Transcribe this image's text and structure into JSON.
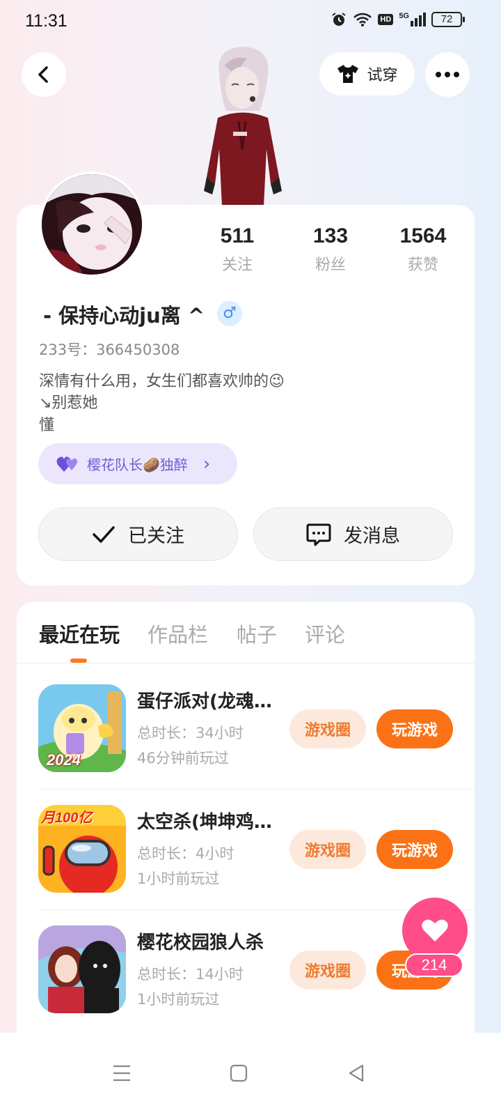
{
  "status_bar": {
    "time": "11:31",
    "network": "5G",
    "hd": "HD",
    "battery": "72"
  },
  "header": {
    "back_icon": "chevron-left-icon",
    "tryon_label": "试穿",
    "more_icon": "more-dots-icon"
  },
  "profile": {
    "stats": [
      {
        "value": "511",
        "label": "关注"
      },
      {
        "value": "133",
        "label": "粉丝"
      },
      {
        "value": "1564",
        "label": "获赞"
      }
    ],
    "username": "- 保持心动ju离 ^",
    "gender_symbol": "♂",
    "uid": "233号：366450308",
    "bio": [
      "深情有什么用，女生们都喜欢帅的😉",
      "↘别惹她",
      "懂"
    ],
    "tag": {
      "text": "樱花队长🥔独醉",
      "arrow": "›"
    },
    "follow_label": "已关注",
    "message_label": "发消息"
  },
  "tabs": [
    {
      "label": "最近在玩",
      "active": true
    },
    {
      "label": "作品栏",
      "active": false
    },
    {
      "label": "帖子",
      "active": false
    },
    {
      "label": "评论",
      "active": false
    }
  ],
  "games": [
    {
      "title": "蛋仔派对(龙魂…",
      "duration": "总时长：34小时",
      "last_played": "46分钟前玩过",
      "circle_label": "游戏圈",
      "play_label": "玩游戏"
    },
    {
      "title": "太空杀(坤坤鸡…",
      "duration": "总时长：4小时",
      "last_played": "1小时前玩过",
      "circle_label": "游戏圈",
      "play_label": "玩游戏"
    },
    {
      "title": "樱花校园狼人杀",
      "duration": "总时长：14小时",
      "last_played": "1小时前玩过",
      "circle_label": "游戏圈",
      "play_label": "玩游戏"
    }
  ],
  "game1_badge": "2024",
  "game2_badge": "月100亿",
  "like": {
    "count": "214"
  },
  "colors": {
    "accent": "#fa7215",
    "like": "#ff4d88",
    "tag": "#6f5bd8"
  }
}
